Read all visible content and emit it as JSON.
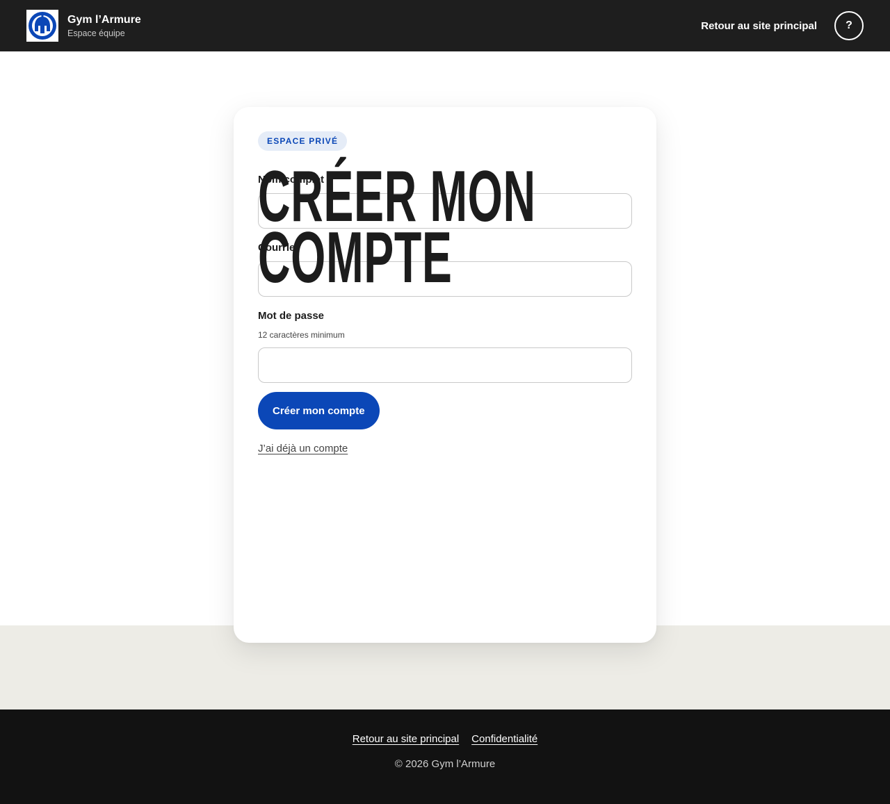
{
  "header": {
    "brand_name": "Gym l’Armure",
    "brand_sub": "Espace équipe",
    "back_link": "Retour au site principal",
    "help_label": "?"
  },
  "card": {
    "badge": "ESPACE PRIVÉ",
    "title_line1": "CRÉER MON",
    "title_line2": "COMPTE",
    "fields": {
      "name": {
        "label": "Nom complet",
        "value": ""
      },
      "email": {
        "label": "Courriel",
        "value": ""
      },
      "password": {
        "label": "Mot de passe",
        "hint": "12 caractères minimum",
        "value": ""
      }
    },
    "submit_label": "Créer mon compte",
    "login_link": "J’ai déjà un compte"
  },
  "footer": {
    "links": [
      "Retour au site principal",
      "Confidentialité"
    ],
    "copyright": "© 2026 Gym l’Armure"
  },
  "colors": {
    "accent": "#0b47b7",
    "header_bg": "#1e1e1e",
    "footer_bg": "#121212",
    "beige": "#edece6"
  },
  "icons": {
    "logo": "spartan-helmet-icon",
    "help": "help-icon"
  }
}
